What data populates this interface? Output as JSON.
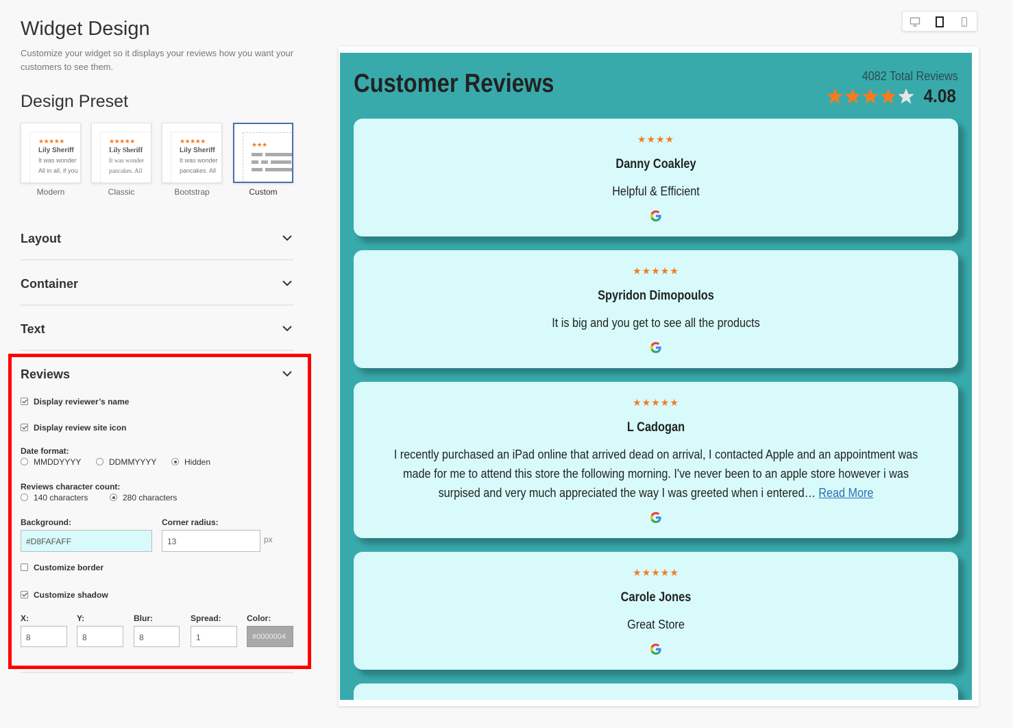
{
  "page": {
    "title": "Widget Design",
    "subtitle": "Customize your widget so it displays your reviews how you want your customers to see them."
  },
  "design_preset": {
    "title": "Design Preset",
    "presets": [
      {
        "label": "Modern",
        "name": "Lily Sheriff",
        "line1": "It was wonder",
        "line2": "All in all, if you"
      },
      {
        "label": "Classic",
        "name": "Lily Sheriff",
        "line1": "It was wonder",
        "line2": "pancakes. All"
      },
      {
        "label": "Bootstrap",
        "name": "Lily Sheriff",
        "line1": "It was wonder",
        "line2": "pancakes. All"
      },
      {
        "label": "Custom"
      }
    ],
    "selected": "Custom"
  },
  "sections": {
    "layout": "Layout",
    "container": "Container",
    "text": "Text",
    "reviews": "Reviews"
  },
  "reviews_settings": {
    "display_name_label": "Display reviewer’s name",
    "display_name_checked": true,
    "display_icon_label": "Display review site icon",
    "display_icon_checked": true,
    "date_format_label": "Date format:",
    "date_options": [
      "MMDDYYYY",
      "DDMMYYYY",
      "Hidden"
    ],
    "date_selected": "Hidden",
    "char_count_label": "Reviews character count:",
    "char_options": [
      "140 characters",
      "280 characters"
    ],
    "char_selected": "280 characters",
    "background_label": "Background:",
    "background_value": "#D8FAFAFF",
    "corner_radius_label": "Corner radius:",
    "corner_radius_value": "13",
    "corner_radius_unit": "px",
    "customize_border_label": "Customize border",
    "customize_border_checked": false,
    "customize_shadow_label": "Customize shadow",
    "customize_shadow_checked": true,
    "shadow": {
      "x_label": "X:",
      "x": "8",
      "y_label": "Y:",
      "y": "8",
      "blur_label": "Blur:",
      "blur": "8",
      "spread_label": "Spread:",
      "spread": "1",
      "color_label": "Color:",
      "color": "#0000004"
    }
  },
  "device_toggle": [
    "desktop-icon",
    "tablet-icon",
    "mobile-icon"
  ],
  "preview": {
    "title": "Customer Reviews",
    "total_reviews": "4082 Total Reviews",
    "rating": "4.08",
    "rating_value": 4.08,
    "read_more": "Read More",
    "reviews": [
      {
        "stars": "★★★★",
        "rating": 4,
        "name": "Danny Coakley",
        "text": "Helpful & Efficient"
      },
      {
        "stars": "★★★★★",
        "rating": 5,
        "name": "Spyridon Dimopoulos",
        "text": "It is big and you get to see all the products"
      },
      {
        "stars": "★★★★★",
        "rating": 5,
        "name": "L Cadogan",
        "text": "I recently purchased an iPad online that arrived dead on arrival, I contacted Apple and an appointment was made for me to attend this store the following morning. I've never been to an apple store however i was surpised and very much appreciated the way I was greeted when i entered…"
      },
      {
        "stars": "★★★★★",
        "rating": 5,
        "name": "Carole Jones",
        "text": "Great Store"
      }
    ]
  },
  "colors": {
    "preview_background": "#38AAAC",
    "card_background": "#D8FAFA",
    "star": "#F47B20",
    "highlight_border": "#FF0000"
  }
}
